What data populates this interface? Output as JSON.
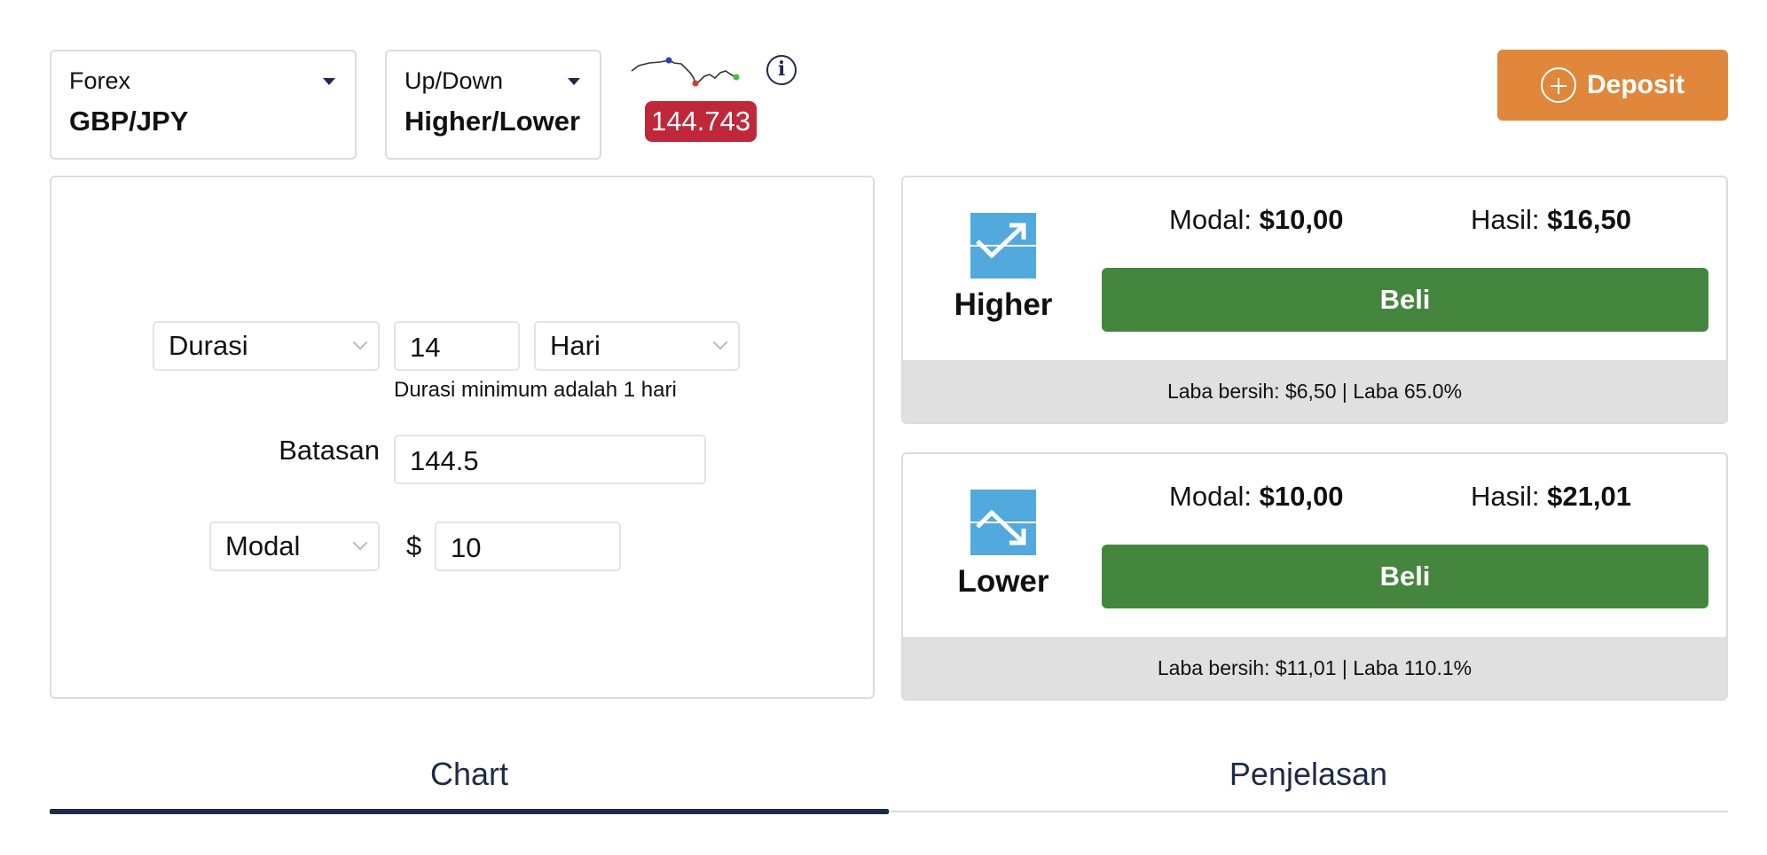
{
  "market_selector": {
    "category": "Forex",
    "instrument": "GBP/JPY"
  },
  "type_selector": {
    "category": "Up/Down",
    "type": "Higher/Lower"
  },
  "price": {
    "value": "144.743",
    "sparkline_icon": "sparkline-icon",
    "info_icon": "info-icon"
  },
  "deposit": {
    "label": "Deposit",
    "icon": "plus-circle-icon",
    "color": "#e0873c"
  },
  "form": {
    "duration_type": "Durasi",
    "duration_value": "14",
    "duration_unit": "Hari",
    "duration_hint": "Durasi minimum adalah 1 hari",
    "barrier_label": "Batasan",
    "barrier_value": "144.5",
    "stake_type": "Modal",
    "currency_symbol": "$",
    "stake_value": "10"
  },
  "contracts": [
    {
      "label": "Higher",
      "icon": "trend-up-icon",
      "stake_label": "Modal:",
      "stake_amount": "$10,00",
      "payout_label": "Hasil:",
      "payout_amount": "$16,50",
      "buy_label": "Beli",
      "footer": "Laba bersih: $6,50 | Laba 65.0%"
    },
    {
      "label": "Lower",
      "icon": "trend-down-icon",
      "stake_label": "Modal:",
      "stake_amount": "$10,00",
      "payout_label": "Hasil:",
      "payout_amount": "$21,01",
      "buy_label": "Beli",
      "footer": "Laba bersih: $11,01 | Laba 110.1%"
    }
  ],
  "tabs": [
    {
      "label": "Chart",
      "active": true
    },
    {
      "label": "Penjelasan",
      "active": false
    }
  ],
  "colors": {
    "price_badge": "#c0273a",
    "buy_button": "#44863d",
    "icon_bg": "#52a9dd",
    "tab_active": "#1f2a4a"
  }
}
